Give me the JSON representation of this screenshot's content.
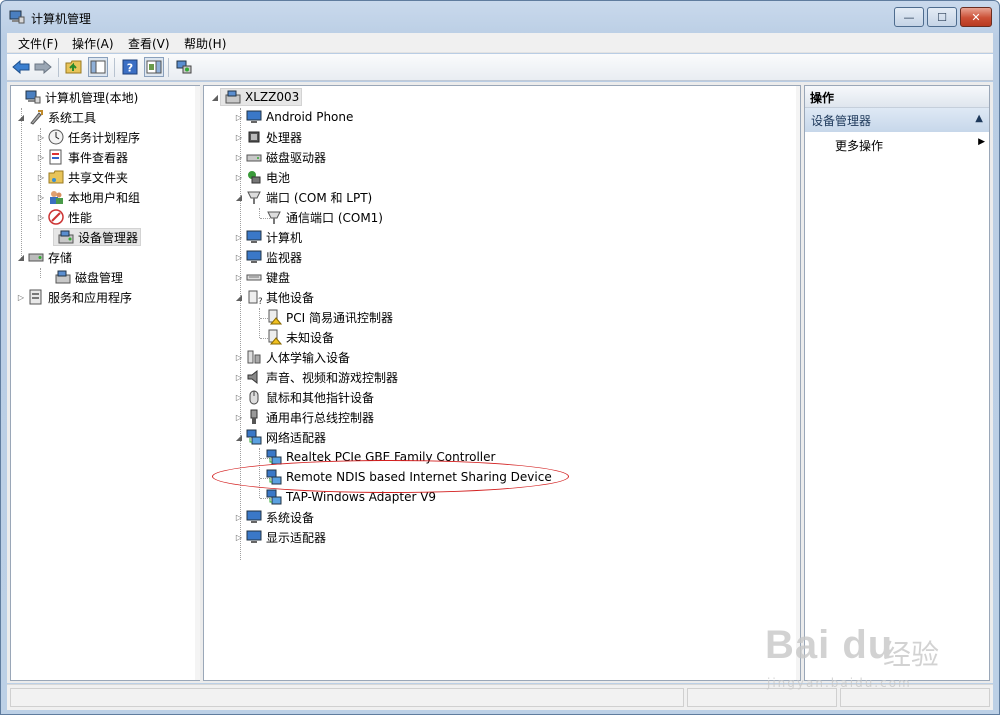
{
  "window": {
    "title": "计算机管理",
    "min_label": "—",
    "max_label": "☐",
    "close_label": "✕"
  },
  "menu": [
    {
      "label": "文件(F)"
    },
    {
      "label": "操作(A)"
    },
    {
      "label": "查看(V)"
    },
    {
      "label": "帮助(H)"
    }
  ],
  "toolbar": {
    "icons": [
      "back-icon",
      "forward-icon",
      "up-folder-icon",
      "show-hide-tree-icon",
      "help-icon",
      "action-pane-icon",
      "device-manager-scan-icon"
    ]
  },
  "left_tree": [
    {
      "label": "计算机管理(本地)",
      "icon": "computer-management-icon",
      "expanded": true
    },
    {
      "label": "系统工具",
      "icon": "tools-icon",
      "expanded": true
    },
    {
      "label": "任务计划程序",
      "icon": "clock-icon"
    },
    {
      "label": "事件查看器",
      "icon": "event-viewer-icon"
    },
    {
      "label": "共享文件夹",
      "icon": "shared-folder-icon"
    },
    {
      "label": "本地用户和组",
      "icon": "users-icon"
    },
    {
      "label": "性能",
      "icon": "performance-icon"
    },
    {
      "label": "设备管理器",
      "icon": "device-manager-icon",
      "selected": true
    },
    {
      "label": "存储",
      "icon": "storage-icon",
      "expanded": true
    },
    {
      "label": "磁盘管理",
      "icon": "disk-management-icon"
    },
    {
      "label": "服务和应用程序",
      "icon": "services-icon"
    }
  ],
  "device_tree": {
    "root": "XLZZ003",
    "items": [
      {
        "label": "Android Phone",
        "icon": "monitor-icon"
      },
      {
        "label": "处理器",
        "icon": "cpu-icon"
      },
      {
        "label": "磁盘驱动器",
        "icon": "disk-drive-icon"
      },
      {
        "label": "电池",
        "icon": "battery-icon"
      },
      {
        "label": "端口 (COM 和 LPT)",
        "icon": "port-icon",
        "expanded": true
      },
      {
        "label": "通信端口 (COM1)",
        "icon": "com-port-icon",
        "child": true
      },
      {
        "label": "计算机",
        "icon": "computer-icon"
      },
      {
        "label": "监视器",
        "icon": "monitor-icon"
      },
      {
        "label": "键盘",
        "icon": "keyboard-icon"
      },
      {
        "label": "其他设备",
        "icon": "unknown-device-icon",
        "expanded": true
      },
      {
        "label": "PCI 简易通讯控制器",
        "icon": "warning-device-icon",
        "child": true
      },
      {
        "label": "未知设备",
        "icon": "warning-device-icon",
        "child": true
      },
      {
        "label": "人体学输入设备",
        "icon": "hid-icon"
      },
      {
        "label": "声音、视频和游戏控制器",
        "icon": "speaker-icon"
      },
      {
        "label": "鼠标和其他指针设备",
        "icon": "mouse-icon"
      },
      {
        "label": "通用串行总线控制器",
        "icon": "usb-icon"
      },
      {
        "label": "网络适配器",
        "icon": "network-icon",
        "expanded": true
      },
      {
        "label": "Realtek PCIe GBE Family Controller",
        "icon": "network-icon",
        "child": true
      },
      {
        "label": "Remote NDIS based Internet Sharing Device",
        "icon": "network-icon",
        "child": true,
        "highlighted": true
      },
      {
        "label": "TAP-Windows Adapter V9",
        "icon": "network-icon",
        "child": true
      },
      {
        "label": "系统设备",
        "icon": "system-device-icon"
      },
      {
        "label": "显示适配器",
        "icon": "display-adapter-icon"
      }
    ]
  },
  "actions": {
    "header": "操作",
    "section": "设备管理器",
    "more": "更多操作"
  },
  "watermark": {
    "logo": "Bai du",
    "cn": "经验",
    "url": "jingyan.baidu.com"
  },
  "colors": {
    "accent": "#1e395b",
    "highlight_ring": "#d32020"
  }
}
